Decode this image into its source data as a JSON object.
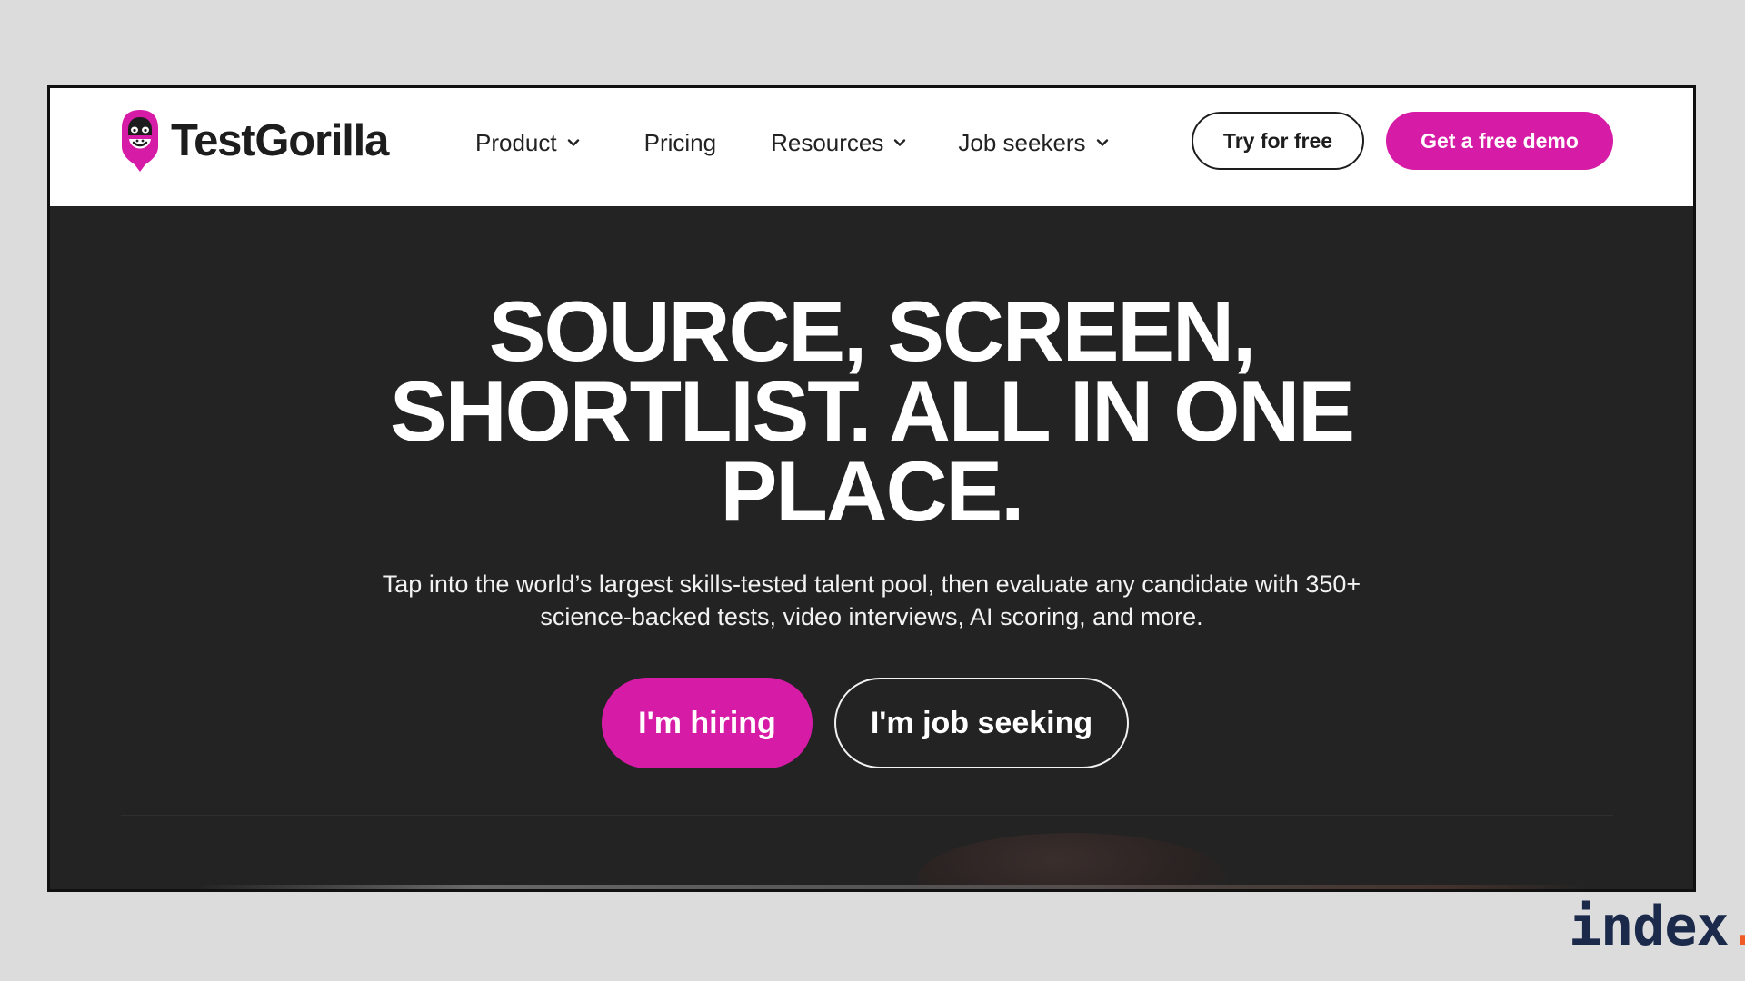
{
  "header": {
    "logo_text": "TestGorilla",
    "nav": [
      {
        "label": "Product",
        "has_dropdown": true
      },
      {
        "label": "Pricing",
        "has_dropdown": false
      },
      {
        "label": "Resources",
        "has_dropdown": true
      },
      {
        "label": "Job seekers",
        "has_dropdown": true
      }
    ],
    "try_label": "Try for free",
    "demo_label": "Get a free demo"
  },
  "hero": {
    "title_line1": "SOURCE, SCREEN,",
    "title_line2": "SHORTLIST. ALL IN ONE",
    "title_line3": "PLACE.",
    "sub_line1": "Tap into the world’s largest skills-tested talent pool, then evaluate any candidate with 350+",
    "sub_line2": "science-backed tests, video interviews, AI scoring, and more.",
    "hiring_label": "I'm hiring",
    "seeking_label": "I'm job seeking"
  },
  "watermark": {
    "text": "index",
    "dot": "."
  },
  "colors": {
    "brand": "#d61ba6",
    "hero_bg": "#232323",
    "page_bg": "#dcdcdc",
    "watermark_text": "#1b2a4b",
    "watermark_dot": "#f15a24"
  },
  "icons": [
    "gorilla-logo-icon",
    "chevron-down-icon"
  ]
}
